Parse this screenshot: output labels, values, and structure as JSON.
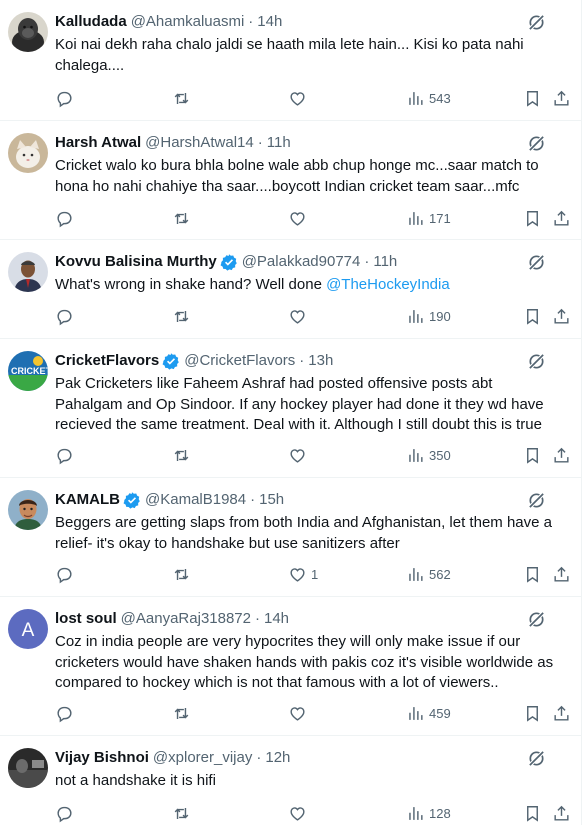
{
  "colors": {
    "accent": "#1d9bf0",
    "secondary_text": "#536471",
    "divider": "#eff3f4"
  },
  "tweets": [
    {
      "name": "Kalludada",
      "handle": "@Ahamkaluasmi",
      "time": "14h",
      "verified": false,
      "avatar": "gorilla-avatar",
      "lines": [
        "Koi nai dekh raha chalo jaldi se haath mila lete hain... Kisi ko pata nahi",
        "chalega...."
      ],
      "mention": "",
      "views": "543",
      "likes": ""
    },
    {
      "name": "Harsh Atwal",
      "handle": "@HarshAtwal14",
      "time": "11h",
      "verified": false,
      "avatar": "cat-avatar",
      "lines": [
        "Cricket walo ko bura bhla bolne wale abb chup honge mc...saar match to",
        "hona ho nahi chahiye tha saar....boycott Indian cricket team saar...mfc"
      ],
      "mention": "",
      "views": "171",
      "likes": ""
    },
    {
      "name": "Kovvu Balisina Murthy",
      "handle": "@Palakkad90774",
      "time": "11h",
      "verified": true,
      "avatar": "man-suit-avatar",
      "lines": [
        "What's wrong in shake hand? Well done "
      ],
      "mention": "@TheHockeyIndia",
      "views": "190",
      "likes": ""
    },
    {
      "name": "CricketFlavors",
      "handle": "@CricketFlavors",
      "time": "13h",
      "verified": true,
      "avatar": "cricket-logo-avatar",
      "lines": [
        "Pak Cricketers like Faheem Ashraf had posted offensive posts abt",
        "Pahalgam and Op Sindoor. If any hockey player had done it they wd have",
        "recieved the same treatment. Deal with it. Although I still doubt this is true"
      ],
      "mention": "",
      "views": "350",
      "likes": ""
    },
    {
      "name": "KAMALB",
      "handle": "@KamalB1984",
      "time": "15h",
      "verified": true,
      "avatar": "cartoon-man-avatar",
      "lines": [
        "Beggers are getting slaps from both India and Afghanistan, let them have a",
        "relief- it's okay to handshake but use sanitizers after"
      ],
      "mention": "",
      "views": "562",
      "likes": "1"
    },
    {
      "name": "lost soul",
      "handle": "@AanyaRaj318872",
      "time": "14h",
      "verified": false,
      "avatar": "letter-a-avatar",
      "initial": "A",
      "lines": [
        "Coz in india people are very hypocrites they will only make issue if our",
        "cricketers would have shaken hands with pakis coz it's visible worldwide as",
        "compared to hockey which is not that famous with a lot of viewers.."
      ],
      "mention": "",
      "views": "459",
      "likes": ""
    },
    {
      "name": "Vijay Bishnoi",
      "handle": "@xplorer_vijay",
      "time": "12h",
      "verified": false,
      "avatar": "dark-photo-avatar",
      "lines": [
        "not a handshake it is hifi"
      ],
      "mention": "",
      "views": "128",
      "likes": ""
    }
  ]
}
